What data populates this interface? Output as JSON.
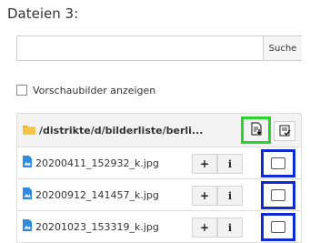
{
  "header": {
    "title": "Dateien 3:"
  },
  "search": {
    "value": "",
    "button_label": "Suche"
  },
  "thumbnails_toggle": {
    "label": "Vorschaubilder anzeigen",
    "checked": false
  },
  "folder": {
    "path": "/distrikte/d/bilderliste/berli..."
  },
  "files": [
    {
      "name": "20200411_152932_k.jpg",
      "plus_label": "+",
      "info_label": "i"
    },
    {
      "name": "20200912_141457_k.jpg",
      "plus_label": "+",
      "info_label": "i"
    },
    {
      "name": "20201023_153319_k.jpg",
      "plus_label": "+",
      "info_label": "i"
    }
  ],
  "colors": {
    "highlight_green": "#2ad42a",
    "highlight_blue": "#1029d6",
    "folder_icon": "#f0b429",
    "file_icon": "#2f8be0"
  },
  "icons": {
    "folder": "folder-icon",
    "file": "image-file-icon",
    "import_all": "import-all-icon",
    "select_all": "select-all-icon"
  }
}
